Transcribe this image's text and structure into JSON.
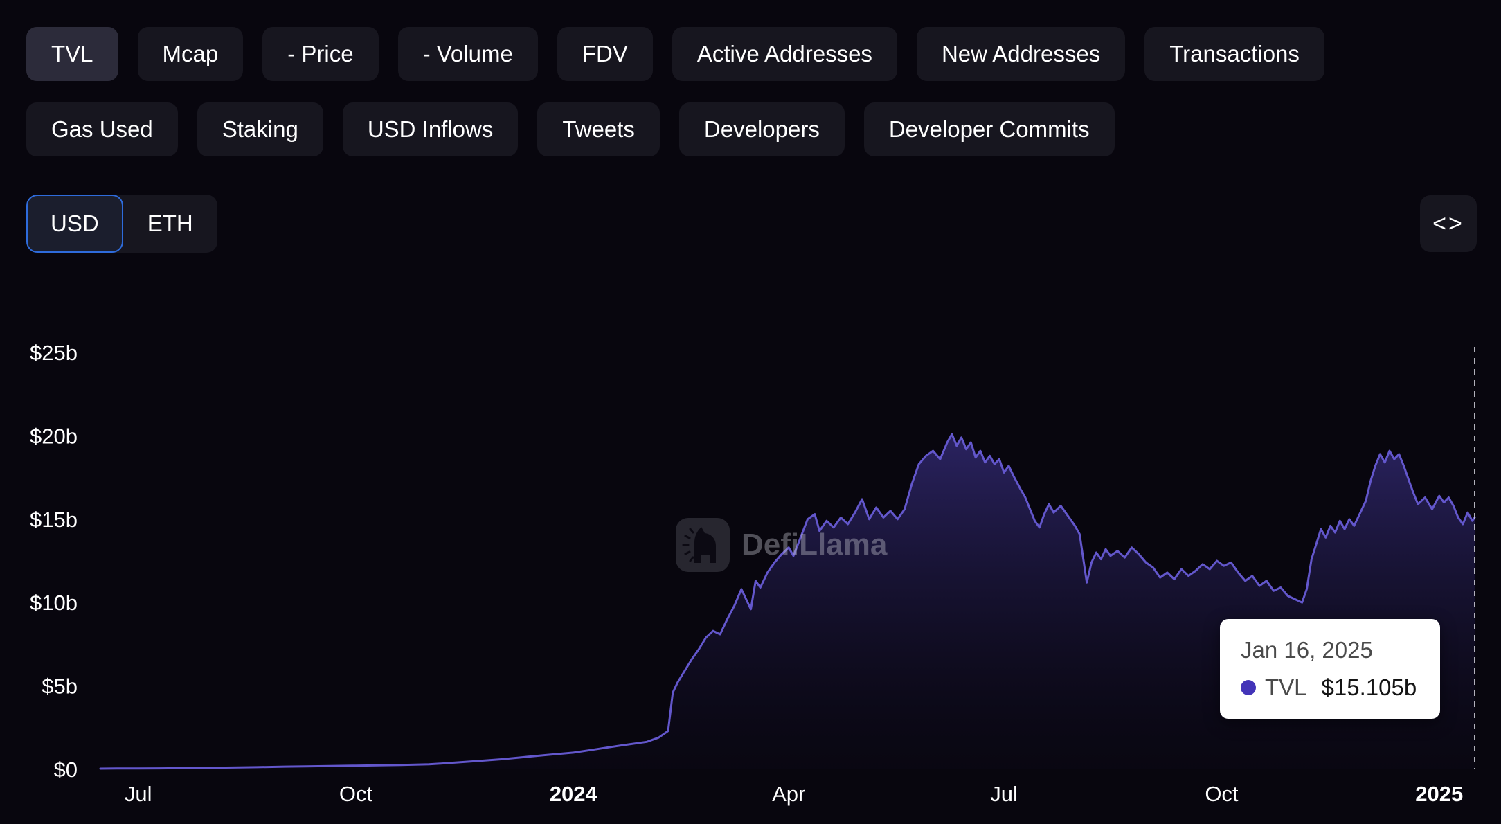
{
  "tabs_row1": [
    {
      "label": "TVL",
      "selected": true
    },
    {
      "label": "Mcap",
      "selected": false
    },
    {
      "label": "- Price",
      "selected": false
    },
    {
      "label": "- Volume",
      "selected": false
    },
    {
      "label": "FDV",
      "selected": false
    },
    {
      "label": "Active Addresses",
      "selected": false
    },
    {
      "label": "New Addresses",
      "selected": false
    },
    {
      "label": "Transactions",
      "selected": false
    }
  ],
  "tabs_row2": [
    {
      "label": "Gas Used",
      "selected": false
    },
    {
      "label": "Staking",
      "selected": false
    },
    {
      "label": "USD Inflows",
      "selected": false
    },
    {
      "label": "Tweets",
      "selected": false
    },
    {
      "label": "Developers",
      "selected": false
    },
    {
      "label": "Developer Commits",
      "selected": false
    }
  ],
  "currency_toggle": {
    "options": [
      "USD",
      "ETH"
    ],
    "selected": "USD"
  },
  "embed_button": {
    "label": "<>"
  },
  "watermark": {
    "text": "DefiLlama"
  },
  "tooltip": {
    "date": "Jan 16, 2025",
    "series": "TVL",
    "value": "$15.105b"
  },
  "colors": {
    "page_bg": "#08060e",
    "tab_bg": "#17161f",
    "tab_selected_bg": "#2c2b3a",
    "toggle_border": "#2e6bdb",
    "accent_line": "#6357cc",
    "tooltip_dot": "#4334b8"
  },
  "chart_data": {
    "type": "area",
    "title": "TVL",
    "xlabel": "",
    "ylabel": "",
    "unit": "billions USD",
    "grid": false,
    "legend_position": "none",
    "ylim": [
      0,
      25
    ],
    "x_range": [
      "2023-06-15",
      "2025-01-16"
    ],
    "y_ticks": [
      {
        "value": 25,
        "label": "$25b"
      },
      {
        "value": 20,
        "label": "$20b"
      },
      {
        "value": 15,
        "label": "$15b"
      },
      {
        "value": 10,
        "label": "$10b"
      },
      {
        "value": 5,
        "label": "$5b"
      },
      {
        "value": 0,
        "label": "$0"
      }
    ],
    "x_ticks": [
      {
        "date": "2023-07-01",
        "label": "Jul",
        "bold": false
      },
      {
        "date": "2023-10-01",
        "label": "Oct",
        "bold": false
      },
      {
        "date": "2024-01-01",
        "label": "2024",
        "bold": true
      },
      {
        "date": "2024-04-01",
        "label": "Apr",
        "bold": false
      },
      {
        "date": "2024-07-01",
        "label": "Jul",
        "bold": false
      },
      {
        "date": "2024-10-01",
        "label": "Oct",
        "bold": false
      },
      {
        "date": "2025-01-01",
        "label": "2025",
        "bold": true
      }
    ],
    "crosshair_date": "2025-01-16",
    "series": [
      {
        "name": "TVL",
        "color": "#6357cc",
        "fill_top": "rgba(77,64,180,0.5)",
        "fill_bottom": "rgba(18,14,42,0.12)",
        "points": [
          [
            "2023-06-15",
            0.04
          ],
          [
            "2023-06-22",
            0.05
          ],
          [
            "2023-07-01",
            0.05
          ],
          [
            "2023-07-10",
            0.06
          ],
          [
            "2023-07-20",
            0.07
          ],
          [
            "2023-08-01",
            0.09
          ],
          [
            "2023-08-10",
            0.11
          ],
          [
            "2023-08-20",
            0.13
          ],
          [
            "2023-09-01",
            0.16
          ],
          [
            "2023-09-10",
            0.18
          ],
          [
            "2023-09-20",
            0.2
          ],
          [
            "2023-10-01",
            0.22
          ],
          [
            "2023-10-10",
            0.24
          ],
          [
            "2023-10-20",
            0.26
          ],
          [
            "2023-11-01",
            0.3
          ],
          [
            "2023-11-10",
            0.38
          ],
          [
            "2023-11-20",
            0.48
          ],
          [
            "2023-12-01",
            0.6
          ],
          [
            "2023-12-10",
            0.72
          ],
          [
            "2023-12-20",
            0.85
          ],
          [
            "2024-01-01",
            1.0
          ],
          [
            "2024-01-08",
            1.15
          ],
          [
            "2024-01-15",
            1.3
          ],
          [
            "2024-01-22",
            1.45
          ],
          [
            "2024-02-01",
            1.65
          ],
          [
            "2024-02-06",
            1.9
          ],
          [
            "2024-02-10",
            2.3
          ],
          [
            "2024-02-12",
            4.6
          ],
          [
            "2024-02-14",
            5.2
          ],
          [
            "2024-02-17",
            5.9
          ],
          [
            "2024-02-20",
            6.6
          ],
          [
            "2024-02-23",
            7.2
          ],
          [
            "2024-02-26",
            7.9
          ],
          [
            "2024-02-29",
            8.3
          ],
          [
            "2024-03-03",
            8.1
          ],
          [
            "2024-03-06",
            9.0
          ],
          [
            "2024-03-09",
            9.8
          ],
          [
            "2024-03-12",
            10.8
          ],
          [
            "2024-03-14",
            10.2
          ],
          [
            "2024-03-16",
            9.6
          ],
          [
            "2024-03-18",
            11.3
          ],
          [
            "2024-03-20",
            10.9
          ],
          [
            "2024-03-23",
            11.8
          ],
          [
            "2024-03-26",
            12.4
          ],
          [
            "2024-03-29",
            12.9
          ],
          [
            "2024-04-01",
            13.3
          ],
          [
            "2024-04-03",
            12.8
          ],
          [
            "2024-04-06",
            13.9
          ],
          [
            "2024-04-09",
            15.0
          ],
          [
            "2024-04-12",
            15.3
          ],
          [
            "2024-04-14",
            14.3
          ],
          [
            "2024-04-17",
            14.9
          ],
          [
            "2024-04-20",
            14.5
          ],
          [
            "2024-04-23",
            15.1
          ],
          [
            "2024-04-26",
            14.7
          ],
          [
            "2024-04-29",
            15.4
          ],
          [
            "2024-05-02",
            16.2
          ],
          [
            "2024-05-05",
            15.0
          ],
          [
            "2024-05-08",
            15.7
          ],
          [
            "2024-05-11",
            15.1
          ],
          [
            "2024-05-14",
            15.5
          ],
          [
            "2024-05-17",
            15.0
          ],
          [
            "2024-05-20",
            15.6
          ],
          [
            "2024-05-23",
            17.1
          ],
          [
            "2024-05-26",
            18.3
          ],
          [
            "2024-05-29",
            18.8
          ],
          [
            "2024-06-01",
            19.1
          ],
          [
            "2024-06-04",
            18.6
          ],
          [
            "2024-06-07",
            19.6
          ],
          [
            "2024-06-09",
            20.1
          ],
          [
            "2024-06-11",
            19.4
          ],
          [
            "2024-06-13",
            19.9
          ],
          [
            "2024-06-15",
            19.2
          ],
          [
            "2024-06-17",
            19.6
          ],
          [
            "2024-06-19",
            18.7
          ],
          [
            "2024-06-21",
            19.1
          ],
          [
            "2024-06-23",
            18.4
          ],
          [
            "2024-06-25",
            18.8
          ],
          [
            "2024-06-27",
            18.3
          ],
          [
            "2024-06-29",
            18.6
          ],
          [
            "2024-07-01",
            17.8
          ],
          [
            "2024-07-03",
            18.2
          ],
          [
            "2024-07-05",
            17.6
          ],
          [
            "2024-07-08",
            16.8
          ],
          [
            "2024-07-10",
            16.3
          ],
          [
            "2024-07-12",
            15.6
          ],
          [
            "2024-07-14",
            14.9
          ],
          [
            "2024-07-16",
            14.5
          ],
          [
            "2024-07-18",
            15.3
          ],
          [
            "2024-07-20",
            15.9
          ],
          [
            "2024-07-22",
            15.4
          ],
          [
            "2024-07-25",
            15.8
          ],
          [
            "2024-07-28",
            15.2
          ],
          [
            "2024-07-31",
            14.6
          ],
          [
            "2024-08-02",
            14.1
          ],
          [
            "2024-08-05",
            11.2
          ],
          [
            "2024-08-07",
            12.4
          ],
          [
            "2024-08-09",
            13.0
          ],
          [
            "2024-08-11",
            12.6
          ],
          [
            "2024-08-13",
            13.2
          ],
          [
            "2024-08-15",
            12.8
          ],
          [
            "2024-08-18",
            13.1
          ],
          [
            "2024-08-21",
            12.7
          ],
          [
            "2024-08-24",
            13.3
          ],
          [
            "2024-08-27",
            12.9
          ],
          [
            "2024-08-30",
            12.4
          ],
          [
            "2024-09-02",
            12.1
          ],
          [
            "2024-09-05",
            11.5
          ],
          [
            "2024-09-08",
            11.8
          ],
          [
            "2024-09-11",
            11.4
          ],
          [
            "2024-09-14",
            12.0
          ],
          [
            "2024-09-17",
            11.6
          ],
          [
            "2024-09-20",
            11.9
          ],
          [
            "2024-09-23",
            12.3
          ],
          [
            "2024-09-26",
            12.0
          ],
          [
            "2024-09-29",
            12.5
          ],
          [
            "2024-10-02",
            12.2
          ],
          [
            "2024-10-05",
            12.4
          ],
          [
            "2024-10-08",
            11.8
          ],
          [
            "2024-10-11",
            11.3
          ],
          [
            "2024-10-14",
            11.6
          ],
          [
            "2024-10-17",
            11.0
          ],
          [
            "2024-10-20",
            11.3
          ],
          [
            "2024-10-23",
            10.7
          ],
          [
            "2024-10-26",
            10.9
          ],
          [
            "2024-10-29",
            10.4
          ],
          [
            "2024-11-01",
            10.2
          ],
          [
            "2024-11-04",
            10.0
          ],
          [
            "2024-11-06",
            10.8
          ],
          [
            "2024-11-08",
            12.6
          ],
          [
            "2024-11-10",
            13.5
          ],
          [
            "2024-11-12",
            14.4
          ],
          [
            "2024-11-14",
            13.9
          ],
          [
            "2024-11-16",
            14.6
          ],
          [
            "2024-11-18",
            14.2
          ],
          [
            "2024-11-20",
            14.9
          ],
          [
            "2024-11-22",
            14.4
          ],
          [
            "2024-11-24",
            15.0
          ],
          [
            "2024-11-26",
            14.6
          ],
          [
            "2024-11-28",
            15.2
          ],
          [
            "2024-12-01",
            16.1
          ],
          [
            "2024-12-03",
            17.3
          ],
          [
            "2024-12-05",
            18.2
          ],
          [
            "2024-12-07",
            18.9
          ],
          [
            "2024-12-09",
            18.4
          ],
          [
            "2024-12-11",
            19.1
          ],
          [
            "2024-12-13",
            18.6
          ],
          [
            "2024-12-15",
            18.9
          ],
          [
            "2024-12-17",
            18.2
          ],
          [
            "2024-12-19",
            17.4
          ],
          [
            "2024-12-21",
            16.6
          ],
          [
            "2024-12-23",
            15.9
          ],
          [
            "2024-12-26",
            16.3
          ],
          [
            "2024-12-29",
            15.6
          ],
          [
            "2025-01-01",
            16.4
          ],
          [
            "2025-01-03",
            16.0
          ],
          [
            "2025-01-05",
            16.3
          ],
          [
            "2025-01-07",
            15.8
          ],
          [
            "2025-01-09",
            15.1
          ],
          [
            "2025-01-11",
            14.7
          ],
          [
            "2025-01-13",
            15.4
          ],
          [
            "2025-01-15",
            14.9
          ],
          [
            "2025-01-16",
            15.105
          ]
        ]
      }
    ]
  }
}
